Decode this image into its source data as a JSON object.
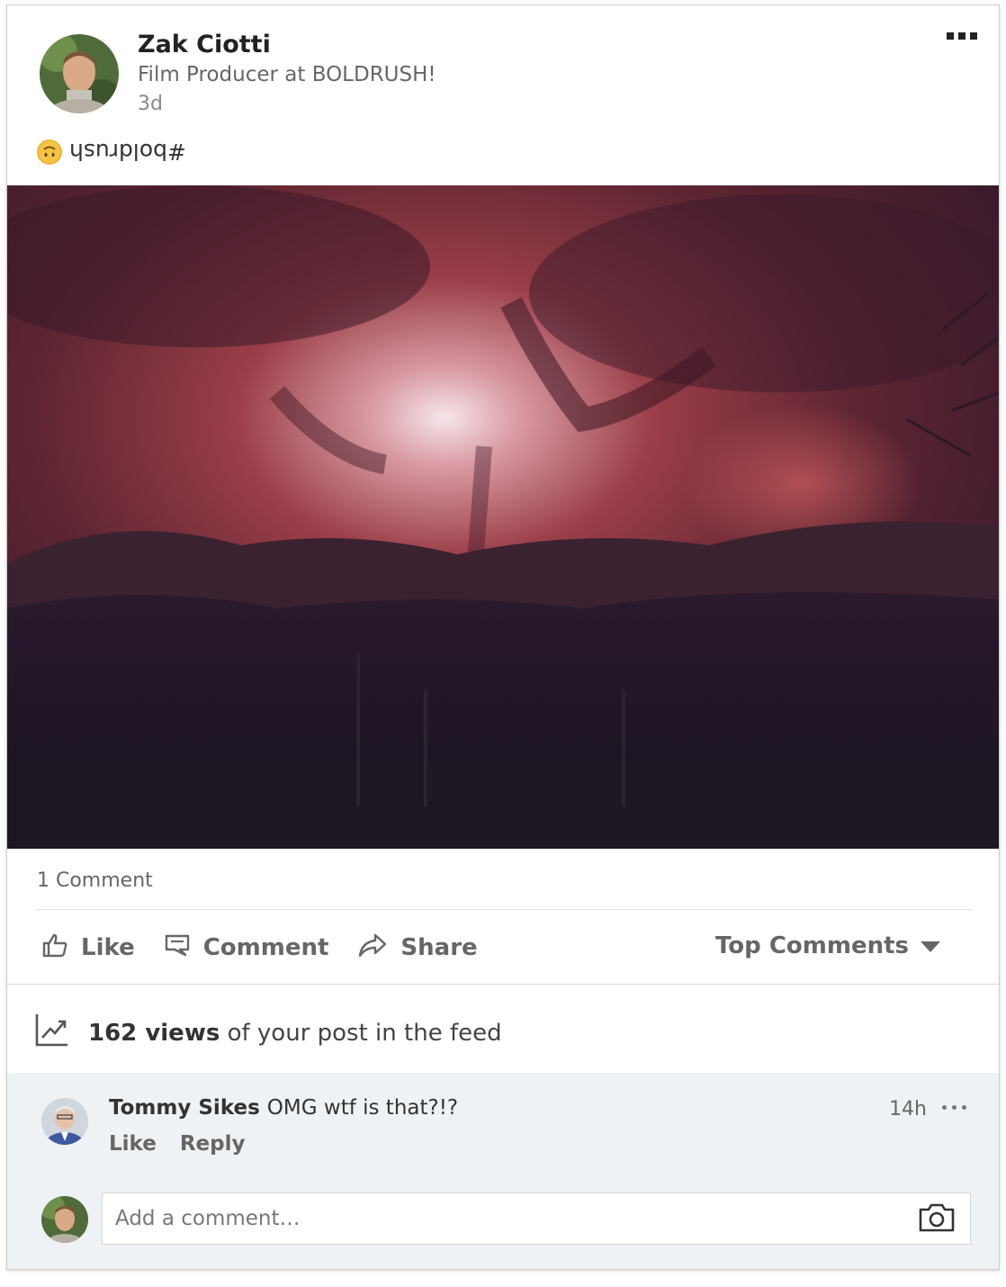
{
  "post": {
    "author_name": "Zak Ciotti",
    "author_headline": "Film Producer at BOLDRUSH!",
    "time_ago": "3d",
    "text": "#boldrush",
    "emoji": "upside-down-face-emoji",
    "comment_count_label": "1 Comment"
  },
  "actions": {
    "like_label": "Like",
    "comment_label": "Comment",
    "share_label": "Share",
    "sort_label": "Top Comments"
  },
  "views": {
    "count_label": "162 views",
    "suffix": "of your post in the feed"
  },
  "comment": {
    "author": "Tommy Sikes",
    "text": "OMG wtf is that?!?",
    "time_ago": "14h",
    "like_label": "Like",
    "reply_label": "Reply"
  },
  "composer": {
    "placeholder": "Add a comment…"
  },
  "colors": {
    "card_bg": "#ffffff",
    "comments_bg": "#eef2f5",
    "text_dark": "#222222",
    "text_muted": "#666666"
  }
}
